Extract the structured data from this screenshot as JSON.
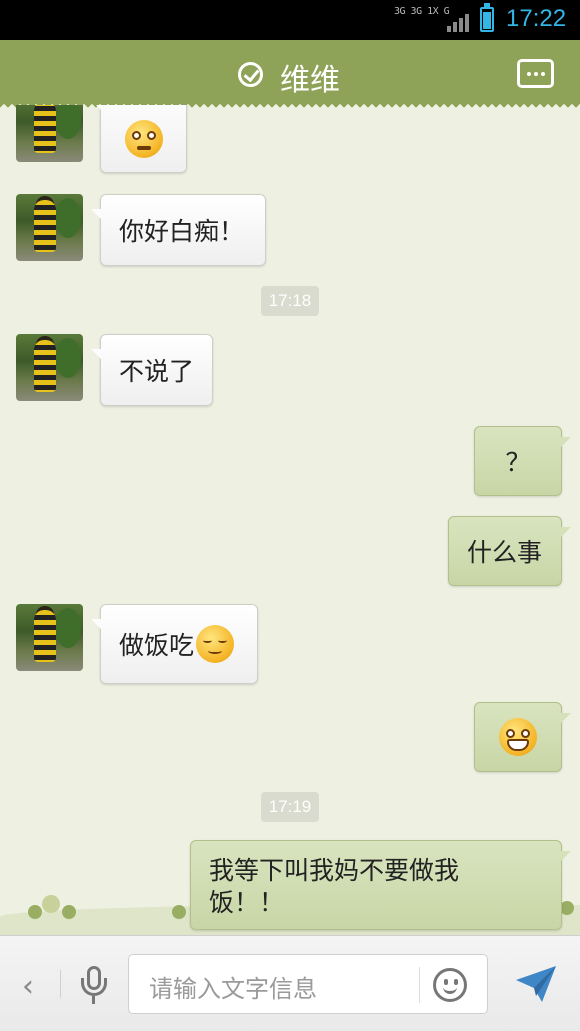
{
  "status_bar": {
    "network": "3G 3G 1X G",
    "time": "17:22"
  },
  "header": {
    "title": "维维",
    "menu_icon": "more-icon",
    "status_icon": "check-circle-icon"
  },
  "messages": [
    {
      "side": "in",
      "type": "emoji",
      "emoji": "shocked-face"
    },
    {
      "side": "in",
      "type": "text",
      "text": "你好白痴！"
    },
    {
      "type": "timestamp",
      "text": "17:18"
    },
    {
      "side": "in",
      "type": "text",
      "text": "不说了"
    },
    {
      "side": "out",
      "type": "text",
      "text": "？"
    },
    {
      "side": "out",
      "type": "text",
      "text": "什么事"
    },
    {
      "side": "in",
      "type": "text",
      "text": "做饭吃",
      "emoji": "smile-face"
    },
    {
      "side": "out",
      "type": "emoji",
      "emoji": "grin-face"
    },
    {
      "type": "timestamp",
      "text": "17:19"
    },
    {
      "side": "out",
      "type": "text",
      "text": "我等下叫我妈不要做我饭！！"
    }
  ],
  "input_bar": {
    "placeholder": "请输入文字信息",
    "back_label": "‹"
  },
  "colors": {
    "header_bg": "#8fa358",
    "chat_bg": "#eef1e2",
    "outgoing_bubble": "#d6e1ba",
    "incoming_bubble": "#ffffff",
    "status_accent": "#33b5e5"
  }
}
